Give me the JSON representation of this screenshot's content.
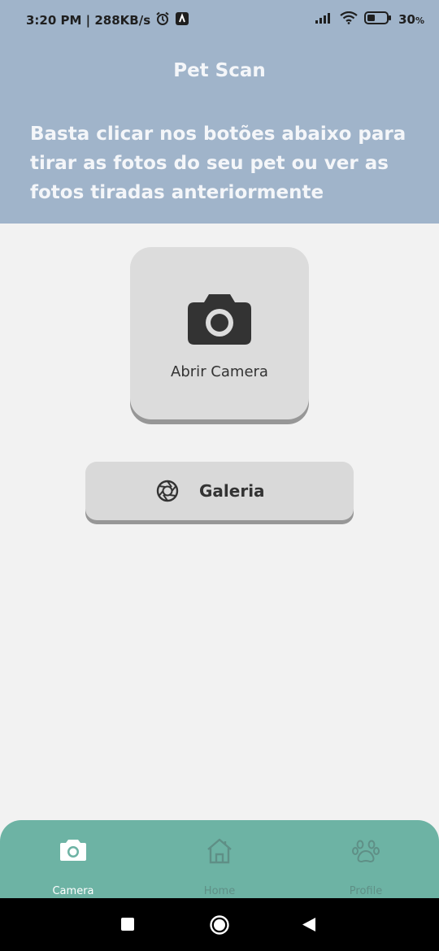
{
  "status_bar": {
    "time_speed": "3:20 PM | 288KB/s",
    "battery": "30",
    "battery_unit": "%",
    "icons": [
      "alarm-icon",
      "app-notification-icon",
      "signal-icon",
      "wifi-icon",
      "battery-icon"
    ]
  },
  "header": {
    "title": "Pet Scan",
    "subtitle": "Basta clicar nos botões abaixo para tirar as fotos do seu pet ou ver as fotos tiradas anteriormente"
  },
  "camera_card": {
    "label": "Abrir Camera",
    "icon": "camera-icon"
  },
  "gallery_button": {
    "label": "Galeria",
    "icon": "aperture-icon"
  },
  "bottom_nav": {
    "items": [
      {
        "label": "Camera",
        "icon": "camera-icon",
        "active": true
      },
      {
        "label": "Home",
        "icon": "home-icon",
        "active": false
      },
      {
        "label": "Profile",
        "icon": "paw-icon",
        "active": false
      }
    ]
  },
  "colors": {
    "header_bg": "#a0b4ca",
    "page_bg": "#f2f2f2",
    "card_bg": "#dcdcdc",
    "nav_bg": "#6db3a4",
    "nav_active": "#ffffff",
    "nav_inactive": "#5f8f86"
  }
}
